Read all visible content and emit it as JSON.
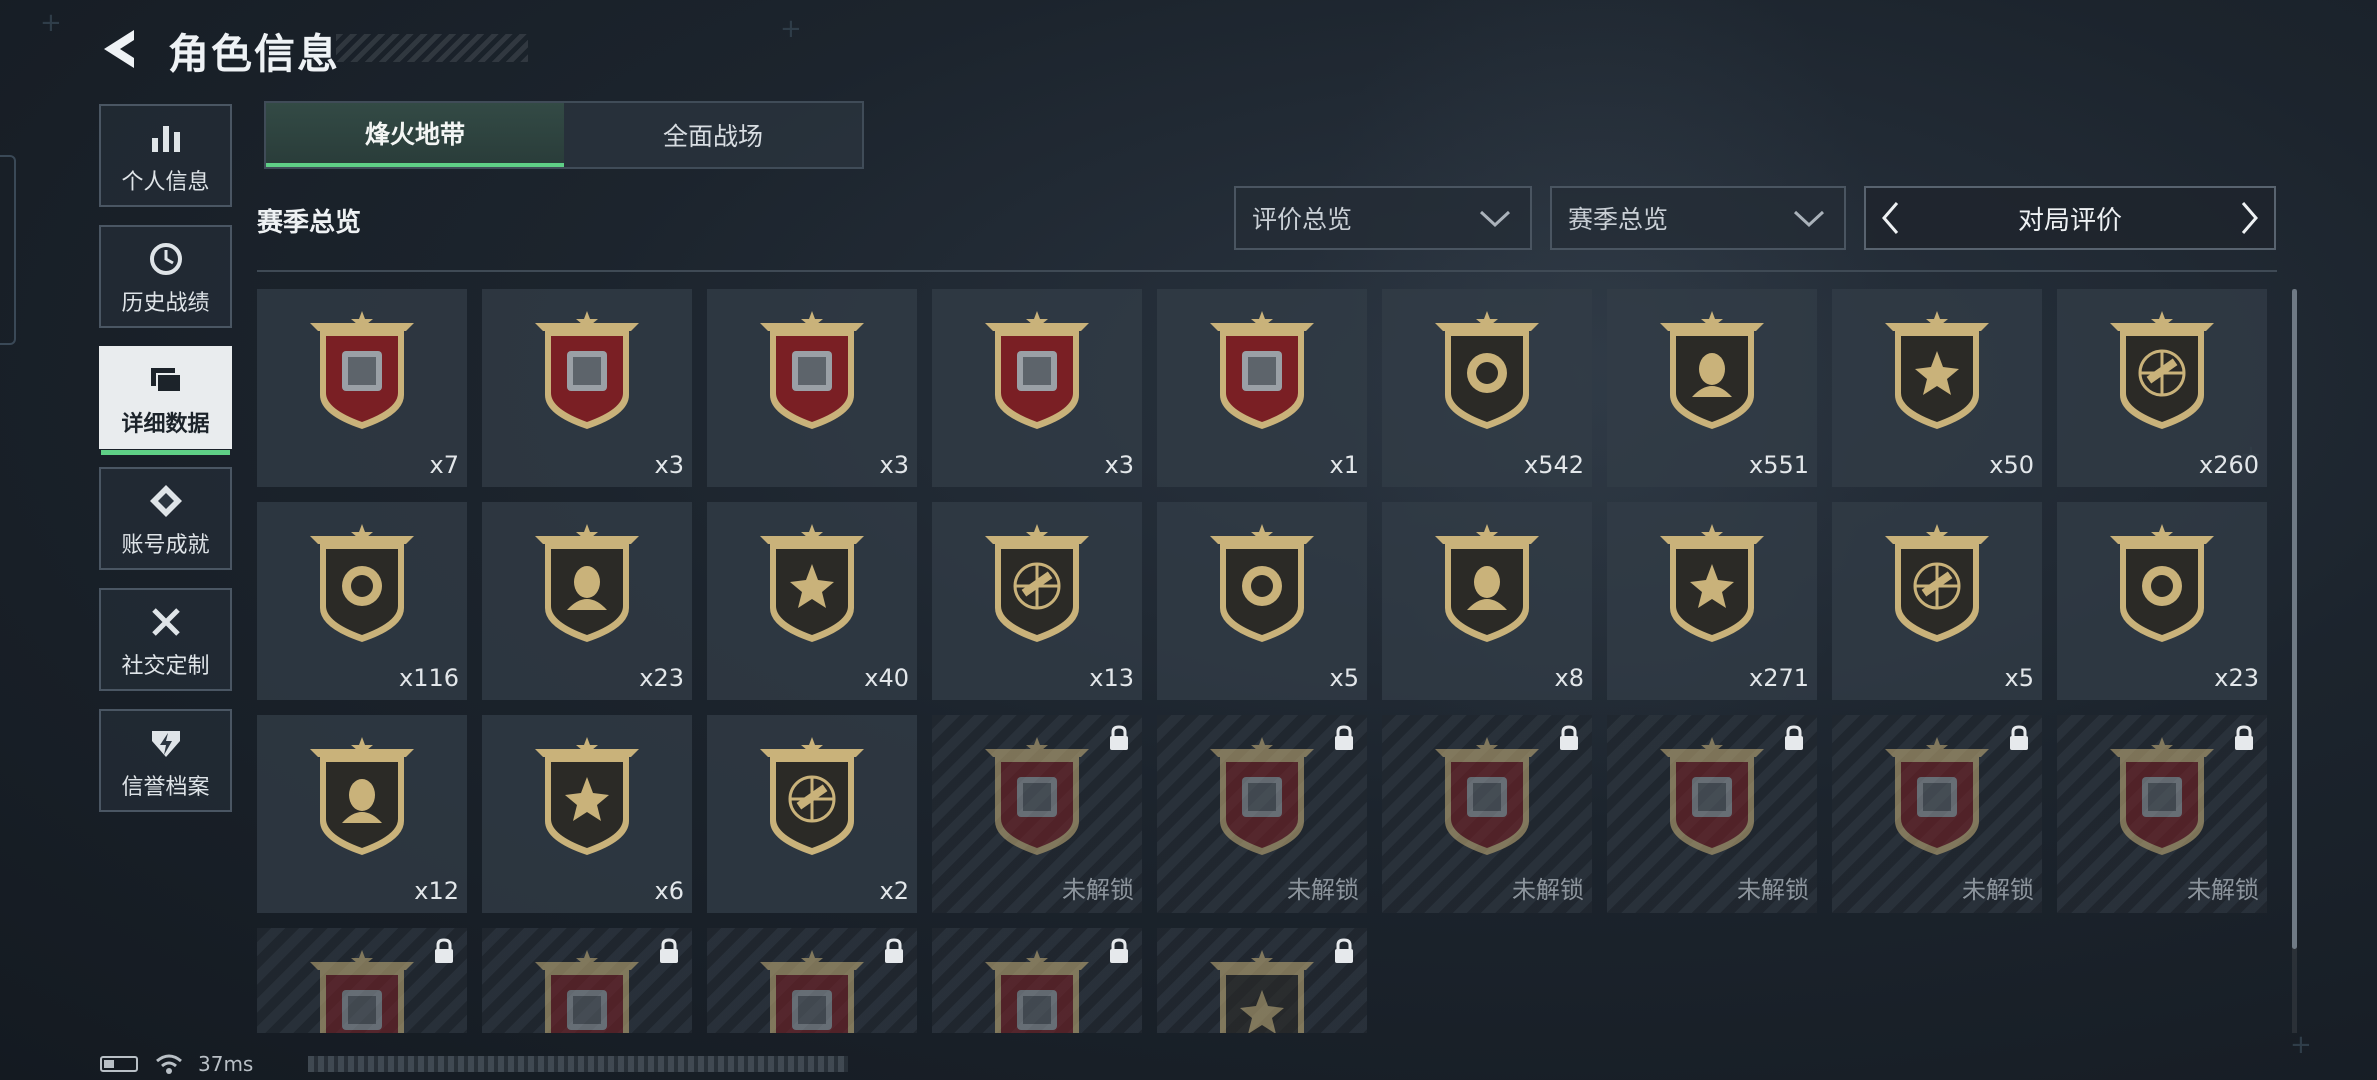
{
  "header": {
    "title": "角色信息"
  },
  "sidebar": {
    "items": [
      {
        "label": "个人信息",
        "icon": "bar-chart-icon"
      },
      {
        "label": "历史战绩",
        "icon": "clock-icon"
      },
      {
        "label": "详细数据",
        "icon": "folders-icon",
        "active": true
      },
      {
        "label": "账号成就",
        "icon": "achievement-icon"
      },
      {
        "label": "社交定制",
        "icon": "tools-icon"
      },
      {
        "label": "信誉档案",
        "icon": "shield-bolt-icon"
      }
    ]
  },
  "tabs": [
    {
      "label": "烽火地带",
      "active": true
    },
    {
      "label": "全面战场",
      "active": false
    }
  ],
  "section": {
    "title": "赛季总览"
  },
  "filters": {
    "rating": "评价总览",
    "season": "赛季总览",
    "pager_label": "对局评价"
  },
  "colors": {
    "accent": "#5fcf86",
    "badge_gold": "#c9b27a",
    "badge_red": "#7a1f24",
    "badge_dark": "#2b2a26"
  },
  "badges": [
    {
      "icon": "tank-icon",
      "count": "x7",
      "frame": "red",
      "locked": false
    },
    {
      "icon": "metal-plate-icon",
      "count": "x3",
      "frame": "red",
      "locked": false
    },
    {
      "icon": "circuit-board-icon",
      "count": "x3",
      "frame": "red",
      "locked": false
    },
    {
      "icon": "lantern-icon",
      "count": "x3",
      "frame": "red",
      "locked": false
    },
    {
      "icon": "jeweled-egg-icon",
      "count": "x1",
      "frame": "red",
      "locked": false
    },
    {
      "icon": "skull-burst-icon",
      "count": "x542",
      "frame": "dark",
      "locked": false
    },
    {
      "icon": "laurel-emblem-icon",
      "count": "x551",
      "frame": "dark",
      "locked": false
    },
    {
      "icon": "chevron-emblem-icon",
      "count": "x50",
      "frame": "dark",
      "locked": false
    },
    {
      "icon": "rifle-crosshair-icon",
      "count": "x260",
      "frame": "dark",
      "locked": false
    },
    {
      "icon": "smg-crosshair-icon",
      "count": "x116",
      "frame": "dark",
      "locked": false
    },
    {
      "icon": "shotgun-crosshair-icon",
      "count": "x23",
      "frame": "dark",
      "locked": false
    },
    {
      "icon": "carbine-crosshair-icon",
      "count": "x40",
      "frame": "dark",
      "locked": false
    },
    {
      "icon": "marksman-crosshair-icon",
      "count": "x13",
      "frame": "dark",
      "locked": false
    },
    {
      "icon": "sniper-crosshair-icon",
      "count": "x5",
      "frame": "dark",
      "locked": false
    },
    {
      "icon": "pistol-crosshair-icon",
      "count": "x8",
      "frame": "dark",
      "locked": false
    },
    {
      "icon": "knife-crosshair-icon",
      "count": "x271",
      "frame": "dark",
      "locked": false
    },
    {
      "icon": "operator-beret-icon",
      "count": "x5",
      "frame": "dark",
      "locked": false
    },
    {
      "icon": "operator-hood-icon",
      "count": "x23",
      "frame": "dark",
      "locked": false
    },
    {
      "icon": "operator-portrait-icon",
      "count": "x12",
      "frame": "dark",
      "locked": false
    },
    {
      "icon": "operator-target-icon",
      "count": "x6",
      "frame": "dark",
      "locked": false
    },
    {
      "icon": "operator-mask-icon",
      "count": "x2",
      "frame": "dark",
      "locked": false
    },
    {
      "icon": "meteorite-icon",
      "count": "未解锁",
      "frame": "red",
      "locked": true
    },
    {
      "icon": "orb-icon",
      "count": "未解锁",
      "frame": "red",
      "locked": true
    },
    {
      "icon": "terminal-icon",
      "count": "未解锁",
      "frame": "red",
      "locked": true
    },
    {
      "icon": "control-panel-icon",
      "count": "未解锁",
      "frame": "red",
      "locked": true
    },
    {
      "icon": "server-rack-icon",
      "count": "未解锁",
      "frame": "red",
      "locked": true
    },
    {
      "icon": "machine-icon",
      "count": "未解锁",
      "frame": "red",
      "locked": true
    },
    {
      "icon": "chessboard-icon",
      "count": "",
      "frame": "red",
      "locked": true
    },
    {
      "icon": "vehicle-icon",
      "count": "",
      "frame": "red",
      "locked": true
    },
    {
      "icon": "frame-icon",
      "count": "",
      "frame": "red",
      "locked": true
    },
    {
      "icon": "device-icon",
      "count": "",
      "frame": "red",
      "locked": true
    },
    {
      "icon": "operator-icon",
      "count": "",
      "frame": "dark",
      "locked": true
    }
  ],
  "status": {
    "ping": "37ms"
  }
}
